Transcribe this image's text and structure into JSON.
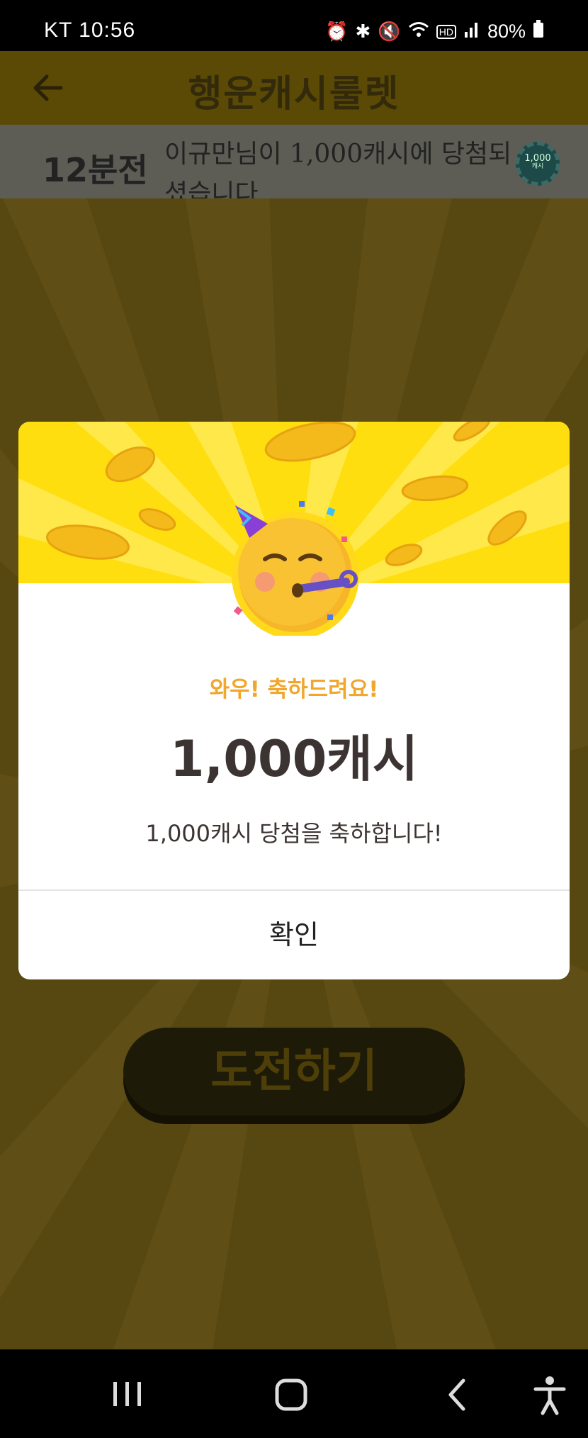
{
  "status_bar": {
    "carrier": "KT",
    "time": "10:56",
    "battery": "80%"
  },
  "app_bar": {
    "title": "행운캐시룰렛"
  },
  "ticker": {
    "time_ago": "12분전",
    "message": "이규만님이 1,000캐시에 당첨되셨습니다.",
    "chip_amount": "1,000",
    "chip_unit": "캐시"
  },
  "challenge_button": {
    "label": "도전하기"
  },
  "modal": {
    "headline": "와우! 축하드려요!",
    "amount": "1,000캐시",
    "description": "1,000캐시 당첨을 축하합니다!",
    "confirm_label": "확인"
  },
  "icons": {
    "back": "back-arrow-icon",
    "emoji": "partying-face-emoji",
    "recents": "recents-icon",
    "home": "home-icon",
    "nav_back": "nav-back-icon",
    "accessibility": "accessibility-icon"
  },
  "colors": {
    "brand_yellow": "#ffde0f",
    "headline_orange": "#f1a62c",
    "text_dark": "#3c3432"
  }
}
